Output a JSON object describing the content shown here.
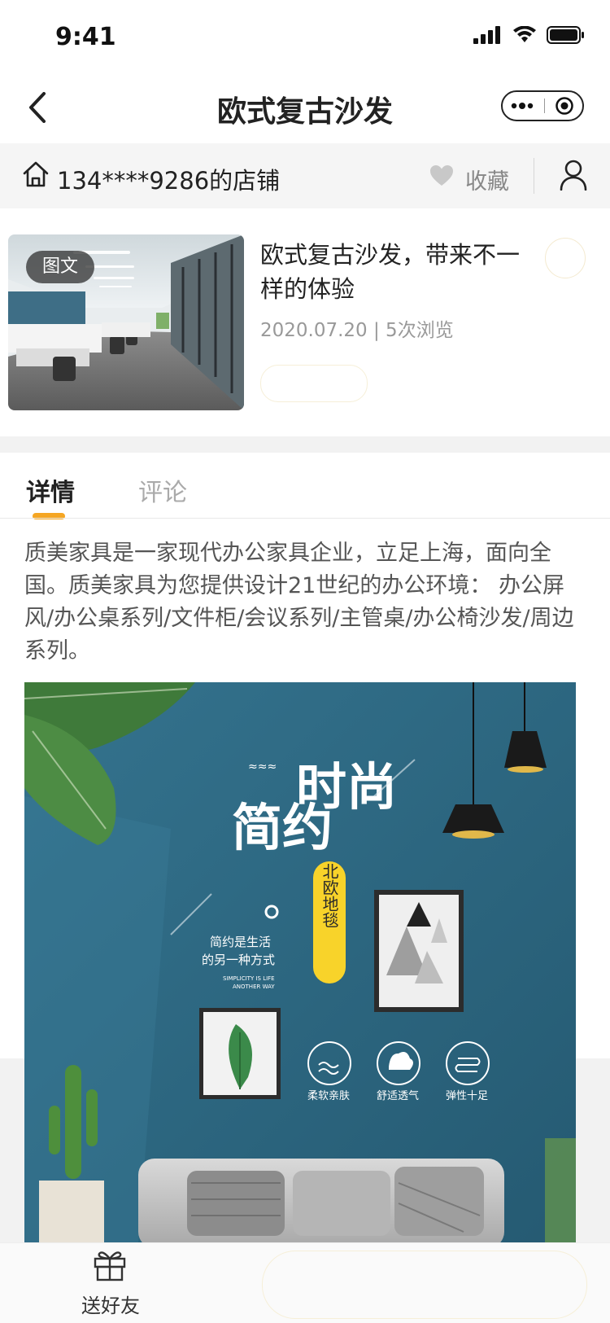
{
  "status_bar": {
    "time": "9:41"
  },
  "nav": {
    "title": "欧式复古沙发"
  },
  "shop": {
    "name": "134****9286的店铺",
    "favorite_label": "收藏"
  },
  "article": {
    "badge": "图文",
    "title": "欧式复古沙发，带来不一样的体验",
    "meta": "2020.07.20 | 5次浏览"
  },
  "tabs": [
    {
      "label": "详情",
      "active": true
    },
    {
      "label": "评论",
      "active": false
    }
  ],
  "description": "质美家具是一家现代办公家具企业，立足上海，面向全国。质美家具为您提供设计21世纪的办公环境： 办公屏风/办公桌系列/文件柜/会议系列/主管桌/办公椅沙发/周边系列。",
  "poster": {
    "title_a": "时尚",
    "title_b": "简约",
    "circle_mark": "。",
    "tag": "北欧地毯",
    "subtitle_1": "简约是生活",
    "subtitle_2": "的另一种方式",
    "subtitle_en_1": "SIMPLICITY IS LIFE",
    "subtitle_en_2": "ANOTHER WAY",
    "features": [
      "柔软亲肤",
      "舒适透气",
      "弹性十足"
    ]
  },
  "bottom_bar": {
    "gift_label": "送好友"
  },
  "colors": {
    "accent": "#f5a623",
    "poster_bg": "#2e6a83",
    "tag_yellow": "#f8d32a"
  }
}
